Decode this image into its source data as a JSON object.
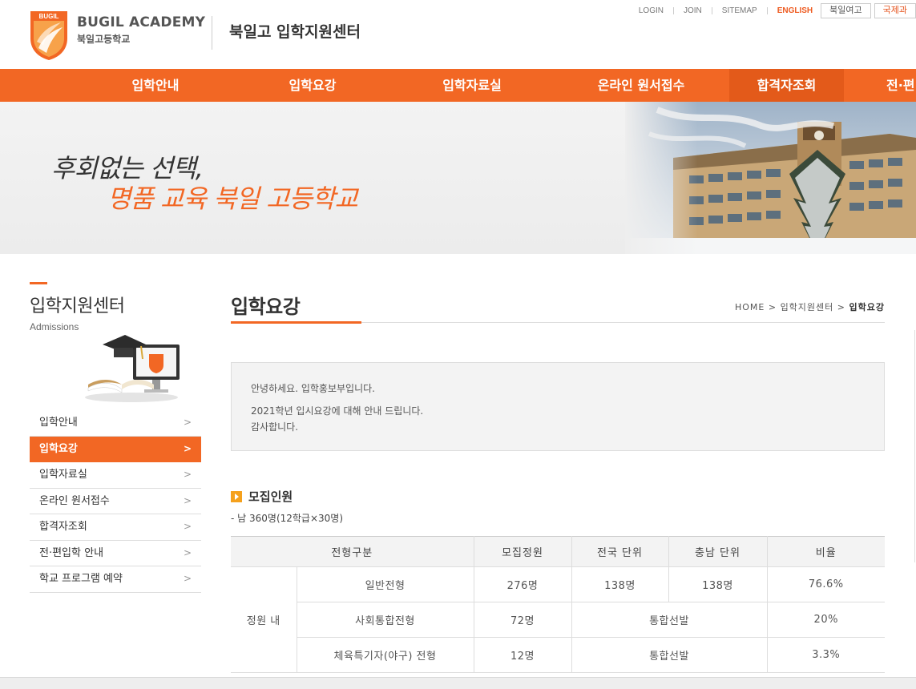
{
  "header": {
    "logo_en": "BUGIL ACADEMY",
    "logo_ko": "북일고등학교",
    "logo_badge": "BUGIL",
    "center_title": "북일고 입학지원센터"
  },
  "util": {
    "login": "LOGIN",
    "join": "JOIN",
    "sitemap": "SITEMAP",
    "english": "ENGLISH",
    "girls_school": "북일여고",
    "international": "국제과"
  },
  "gnb": [
    "입학안내",
    "입학요강",
    "입학자료실",
    "온라인 원서접수",
    "합격자조회",
    "전·편"
  ],
  "banner": {
    "line1": "후회없는 선택,",
    "line2": "명품 교육 북일 고등학교"
  },
  "sidebar": {
    "title": "입학지원센터",
    "subtitle": "Admissions",
    "items": [
      {
        "label": "입학안내",
        "arrow": ">"
      },
      {
        "label": "입학요강",
        "arrow": ">"
      },
      {
        "label": "입학자료실",
        "arrow": ">"
      },
      {
        "label": "온라인 원서접수",
        "arrow": ">"
      },
      {
        "label": "합격자조회",
        "arrow": ">"
      },
      {
        "label": "전·편입학 안내",
        "arrow": ">"
      },
      {
        "label": "학교 프로그램 예약",
        "arrow": ">"
      }
    ]
  },
  "content": {
    "title": "입학요강",
    "breadcrumb": {
      "home": "HOME",
      "sep": ">",
      "center": "입학지원센터",
      "current": "입학요강"
    },
    "greeting": [
      "안녕하세요. 입학홍보부입니다.",
      "2021학년 입시요강에 대해 안내 드립니다.",
      "감사합니다."
    ],
    "section_title": "모집인원",
    "section_desc": "- 남 360명(12학급×30명)",
    "table": {
      "headers": [
        "전형구분",
        "모집정원",
        "전국 단위",
        "충남 단위",
        "비율"
      ],
      "group": "정원 내",
      "rows": [
        {
          "type": "일반전형",
          "quota": "276명",
          "national": "138명",
          "chungnam": "138명",
          "ratio": "76.6%"
        },
        {
          "type": "사회통합전형",
          "quota": "72명",
          "merged": "통합선발",
          "ratio": "20%"
        },
        {
          "type": "체육특기자(야구) 전형",
          "quota": "12명",
          "merged": "통합선발",
          "ratio": "3.3%"
        }
      ]
    }
  }
}
